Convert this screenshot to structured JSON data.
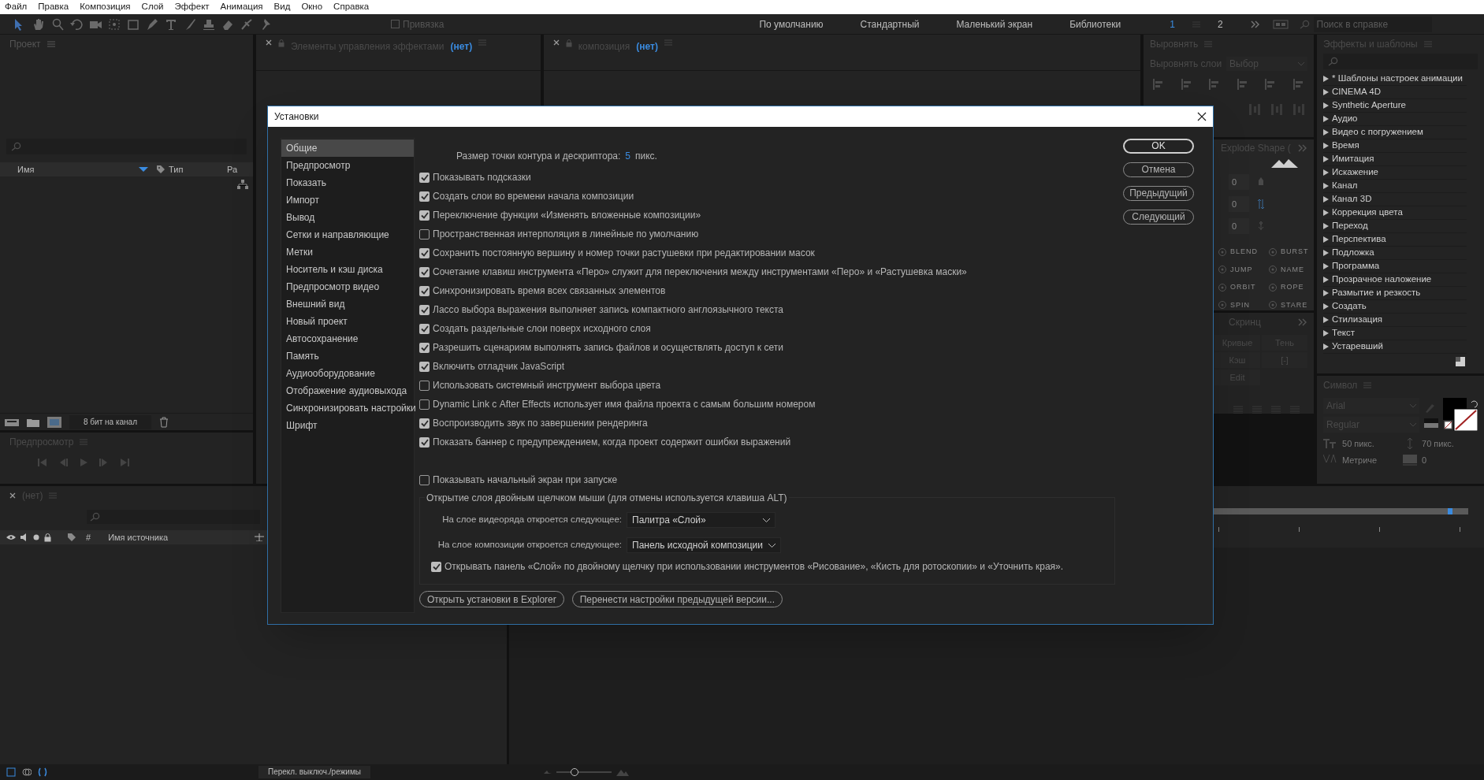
{
  "menu": [
    "Файл",
    "Правка",
    "Композиция",
    "Слой",
    "Эффект",
    "Анимация",
    "Вид",
    "Окно",
    "Справка"
  ],
  "toolbar": {
    "snap": {
      "label": "Привязка",
      "checked": false
    },
    "workspaces": [
      "По умолчанию",
      "Стандартный",
      "Маленький экран",
      "Библиотеки"
    ],
    "pages": [
      {
        "label": "1",
        "selected": true
      },
      {
        "label": "2",
        "selected": false
      }
    ],
    "help_search": {
      "placeholder": "Поиск в справке"
    }
  },
  "project": {
    "title": "Проект",
    "columns": [
      "Имя",
      "Тип",
      "Ра"
    ],
    "depth": "8 бит на канал"
  },
  "preview": {
    "title": "Предпросмотр"
  },
  "effect_controls": {
    "title": "Элементы управления эффектами",
    "target": "(нет)"
  },
  "composition": {
    "title": "композиция",
    "target": "(нет)"
  },
  "align": {
    "title": "Выровнять",
    "align_to_label": "Выровнять слои",
    "align_to_value": "Выбор"
  },
  "explode": {
    "title": "Explode Shape (",
    "values": [
      "0",
      "0",
      "0"
    ],
    "actions": [
      "BLEND",
      "BURST",
      "JUMP",
      "NAME",
      "ORBIT",
      "ROPE",
      "SPIN",
      "STARE"
    ]
  },
  "extra_panel": {
    "title": "Скринц",
    "buttons": [
      "Кривые",
      "Тень",
      "Кэш",
      "[-]",
      "Edit"
    ]
  },
  "effects_presets": {
    "title": "Эффекты и шаблоны",
    "items": [
      "* Шаблоны настроек анимации",
      "CINEMA 4D",
      "Synthetic Aperture",
      "Аудио",
      "Видео с погружением",
      "Время",
      "Имитация",
      "Искажение",
      "Канал",
      "Канал 3D",
      "Коррекция цвета",
      "Переход",
      "Перспектива",
      "Подложка",
      "Программа",
      "Прозрачное наложение",
      "Размытие и резкость",
      "Создать",
      "Стилизация",
      "Текст",
      "Устаревший"
    ]
  },
  "character": {
    "title": "Символ",
    "font": "Arial",
    "style": "Regular",
    "size": "50 пикс.",
    "leading": "70 пикс.",
    "kerning": "Метриче",
    "tracking": "0"
  },
  "timeline": {
    "title": "(нет)",
    "hash": "#",
    "source_column": "Имя источника",
    "toggle": "Перекл. выключ./режимы",
    "zoom": {
      "level": 0.3
    }
  },
  "dialog": {
    "title": "Установки",
    "categories": [
      {
        "label": "Общие",
        "selected": true
      },
      {
        "label": "Предпросмотр",
        "selected": false
      },
      {
        "label": "Показать",
        "selected": false
      },
      {
        "label": "Импорт",
        "selected": false
      },
      {
        "label": "Вывод",
        "selected": false
      },
      {
        "label": "Сетки и направляющие",
        "selected": false
      },
      {
        "label": "Метки",
        "selected": false
      },
      {
        "label": "Носитель и кэш диска",
        "selected": false
      },
      {
        "label": "Предпросмотр видео",
        "selected": false
      },
      {
        "label": "Внешний вид",
        "selected": false
      },
      {
        "label": "Новый проект",
        "selected": false
      },
      {
        "label": "Автосохранение",
        "selected": false
      },
      {
        "label": "Память",
        "selected": false
      },
      {
        "label": "Аудиооборудование",
        "selected": false
      },
      {
        "label": "Отображение аудиовыхода",
        "selected": false
      },
      {
        "label": "Синхронизировать настройки",
        "selected": false
      },
      {
        "label": "Шрифт",
        "selected": false
      }
    ],
    "handle_size": {
      "label": "Размер точки контура и дескриптора:",
      "value": "5",
      "unit": "пикс."
    },
    "options": [
      {
        "label": "Показывать подсказки",
        "checked": true
      },
      {
        "label": "Создать слои во времени начала композиции",
        "checked": true
      },
      {
        "label": "Переключение функции «Изменять вложенные композиции»",
        "checked": true
      },
      {
        "label": "Пространственная интерполяция в линейные по умолчанию",
        "checked": false
      },
      {
        "label": "Сохранить постоянную вершину и номер точки растушевки при редактировании масок",
        "checked": true
      },
      {
        "label": "Сочетание клавиш инструмента «Перо» служит для переключения между инструментами «Перо» и «Растушевка маски»",
        "checked": true
      },
      {
        "label": "Синхронизировать время всех связанных элементов",
        "checked": true
      },
      {
        "label": "Лассо выбора выражения выполняет запись компактного англоязычного текста",
        "checked": true
      },
      {
        "label": "Создать раздельные слои поверх исходного слоя",
        "checked": true
      },
      {
        "label": "Разрешить сценариям выполнять запись файлов и осуществлять доступ к сети",
        "checked": true
      },
      {
        "label": "Включить отладчик JavaScript",
        "checked": true
      },
      {
        "label": "Использовать системный инструмент выбора цвета",
        "checked": false
      },
      {
        "label": "Dynamic Link с After Effects использует имя файла проекта с самым большим номером",
        "checked": false
      },
      {
        "label": "Воспроизводить звук по завершении рендеринга",
        "checked": true
      },
      {
        "label": "Показать баннер с предупреждением, когда проект содержит ошибки выражений",
        "checked": true
      }
    ],
    "startup_screen": {
      "label": "Показывать начальный экран при запуске",
      "checked": false
    },
    "double_click": {
      "title": "Открытие слоя двойным щелчком мыши (для отмены используется клавиша ALT)",
      "footage_label": "На слое видеоряда откроется следующее:",
      "footage_value": "Палитра «Слой»",
      "comp_label": "На слое композиции откроется следующее:",
      "comp_value": "Панель исходной композиции",
      "paint_option": {
        "label": "Открывать панель «Слой» по двойному щелчку при использовании инструментов «Рисование», «Кисть для ротоскопии» и «Уточнить края».",
        "checked": true
      }
    },
    "links": [
      "Открыть установки в Explorer",
      "Перенести настройки предыдущей версии..."
    ],
    "buttons": [
      "OK",
      "Отмена",
      "Предыдущий",
      "Следующий"
    ]
  }
}
